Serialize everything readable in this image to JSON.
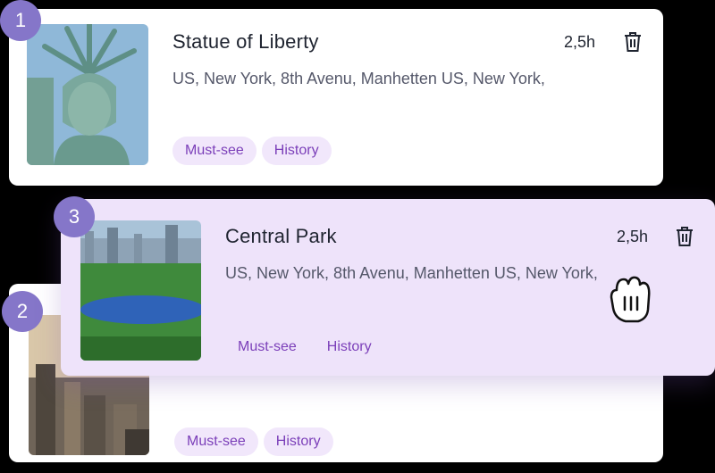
{
  "items": [
    {
      "number": "1",
      "title": "Statue of Liberty",
      "address": "US, New York, 8th Avenu, Manhetten US, New York,",
      "duration": "2,5h",
      "tags": [
        "Must-see",
        "History"
      ],
      "image": "statue-of-liberty-photo"
    },
    {
      "number": "2",
      "title": "",
      "address": "",
      "duration": "",
      "tags": [
        "Must-see",
        "History"
      ],
      "image": "city-skyline-photo"
    },
    {
      "number": "3",
      "title": "Central Park",
      "address": "US, New York, 8th Avenu, Manhetten US, New York,",
      "duration": "2,5h",
      "tags": [
        "Must-see",
        "History"
      ],
      "image": "central-park-photo",
      "state": "dragging"
    }
  ],
  "icons": {
    "delete": "trash-icon",
    "cursor": "grab-hand-icon"
  },
  "colors": {
    "badge": "#8576c9",
    "tag_bg": "#f1e7fb",
    "tag_text": "#7b3fb9",
    "drag_card_bg": "#eee3fa"
  }
}
